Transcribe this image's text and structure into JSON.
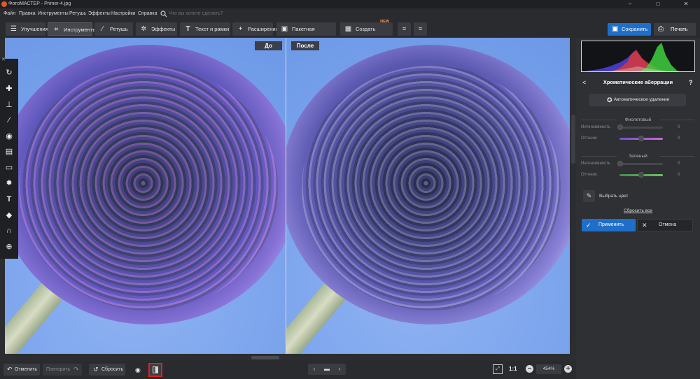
{
  "window": {
    "title": "ФотоМАСТЕР - Primer-4.jpg",
    "controls": [
      "–",
      "□",
      "✕"
    ]
  },
  "menu": {
    "items": [
      "Файл",
      "Правка",
      "Инструменты",
      "Ретушь",
      "Эффекты",
      "Настройки",
      "Справка"
    ],
    "search_placeholder": "Что вы хотите сделать?"
  },
  "toolbar": {
    "tabs": [
      {
        "label": "Улучшения",
        "icon": "sliders-icon"
      },
      {
        "label": "Инструменты",
        "icon": "crop-icon"
      },
      {
        "label": "Ретушь",
        "icon": "brush-icon"
      },
      {
        "label": "Эффекты",
        "icon": "sparkle-icon"
      },
      {
        "label": "Текст и рамки",
        "icon": "text-icon"
      },
      {
        "label": "Расширения",
        "icon": "plus-icon"
      },
      {
        "label": "Пакетная обработка",
        "icon": "batch-icon"
      },
      {
        "label": "Создать коллаж",
        "icon": "collage-icon"
      }
    ],
    "new_badge": "NEW",
    "save_label": "Сохранить",
    "print_label": "Печать"
  },
  "canvas": {
    "before_label": "До",
    "after_label": "После"
  },
  "left_tools": [
    "rotate-icon",
    "healing-icon",
    "stamp-icon",
    "brush-icon",
    "radial-icon",
    "gradient-icon",
    "vignette-icon",
    "light-icon",
    "text-icon",
    "fill-icon",
    "magnet-icon",
    "plant-icon"
  ],
  "panel": {
    "title": "Хроматические аберрации",
    "auto_button": "Автоматическое удаление",
    "sections": [
      {
        "title": "Фиолетовый",
        "sliders": [
          {
            "label": "Интенсивность",
            "value": "0",
            "position": 0.0
          },
          {
            "label": "Оттенок",
            "value": "0",
            "position": 0.5
          }
        ]
      },
      {
        "title": "Зеленый",
        "sliders": [
          {
            "label": "Интенсивность",
            "value": "0",
            "position": 0.0
          },
          {
            "label": "Оттенок",
            "value": "0",
            "position": 0.5
          }
        ]
      }
    ],
    "pick_color": "Выбрать цвет",
    "reset_all": "Сбросить все",
    "apply": "Применить",
    "cancel": "Отмена",
    "colors": {
      "violet_gradient": [
        "#7b4bd6",
        "#c86ad0"
      ],
      "green_gradient": [
        "#3f8f4a",
        "#6fbf6a"
      ]
    }
  },
  "bottom": {
    "undo": "Отменить",
    "redo": "Повторить",
    "reset": "Сбросить",
    "zoom_fit": "fit-icon",
    "zoom_11": "1:1",
    "zoom_value": "454%"
  },
  "colors": {
    "accent": "#1f6fc9",
    "highlight_border": "#e02020",
    "background": "#2b2d31"
  }
}
